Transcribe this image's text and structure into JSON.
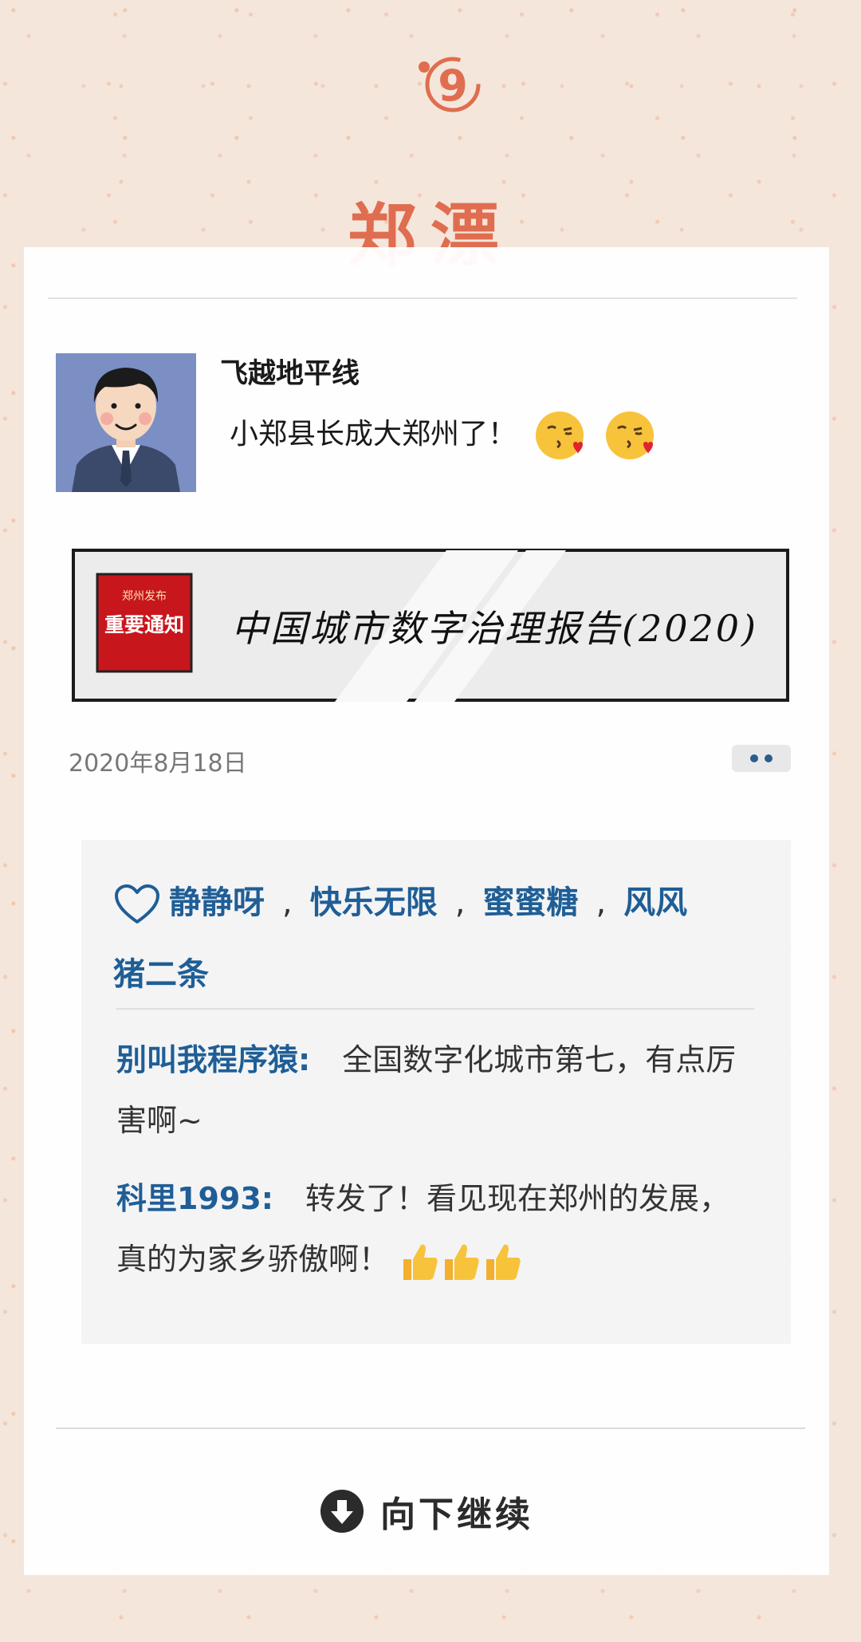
{
  "header": {
    "badge": "9",
    "title": "郑漂"
  },
  "post": {
    "username": "飞越地平线",
    "text": "小郑县长成大郑州了！",
    "emojis": [
      "kissing-face-heart",
      "kissing-face-heart"
    ],
    "banner": {
      "stamp_small": "郑州发布",
      "stamp_main": "重要通知",
      "headline": "中国城市数字治理报告(2020)"
    },
    "date": "2020年8月18日"
  },
  "likes": {
    "names": [
      "静静呀",
      "快乐无限",
      "蜜蜜糖",
      "风风",
      "猪二条"
    ]
  },
  "comments": [
    {
      "author": "别叫我程序猿:",
      "text": "全国数字化城市第七，有点厉害啊~"
    },
    {
      "author": "科里1993:",
      "text": "转发了！看见现在郑州的发展，真的为家乡骄傲啊！",
      "emojis": [
        "thumbs-up",
        "thumbs-up",
        "thumbs-up"
      ]
    }
  ],
  "footer": {
    "continue_label": "向下继续"
  },
  "colors": {
    "accent": "#e06d4f",
    "link_blue": "#1f5e96",
    "stamp_red": "#c8161d"
  }
}
